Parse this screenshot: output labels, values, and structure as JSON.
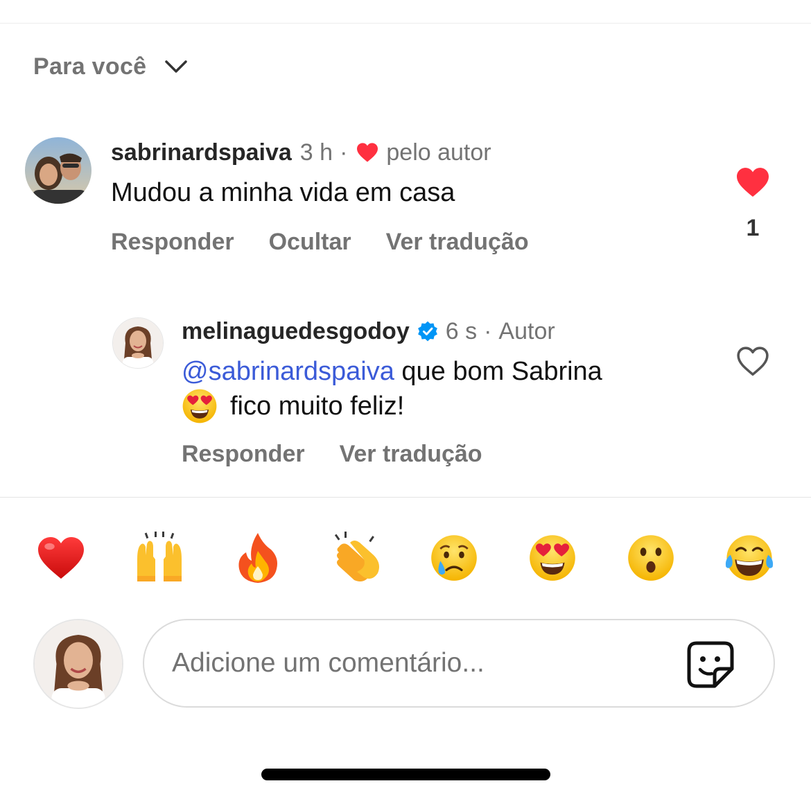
{
  "header": {
    "filter_label": "Para você"
  },
  "comments": [
    {
      "username": "sabrinardspaiva",
      "time": "3 h",
      "separator": "·",
      "liked_by_author_label": "pelo autor",
      "text": "Mudou a minha vida em casa",
      "actions": [
        "Responder",
        "Ocultar",
        "Ver tradução"
      ],
      "like_count": "1",
      "liked": true
    }
  ],
  "reply": {
    "username": "melinaguedesgodoy",
    "verified": true,
    "time": "6 s",
    "separator": "·",
    "role_label": "Autor",
    "mention": "@sabrinardspaiva",
    "text_line1": " que bom Sabrina",
    "text_line2": "fico muito feliz!",
    "actions": [
      "Responder",
      "Ver tradução"
    ],
    "liked": false
  },
  "quick_reactions": [
    "heart-emoji",
    "raising-hands-emoji",
    "fire-emoji",
    "clapping-hands-emoji",
    "crying-face-emoji",
    "heart-eyes-emoji",
    "surprised-face-emoji",
    "tears-of-joy-emoji"
  ],
  "composer": {
    "placeholder": "Adicione um comentário..."
  },
  "colors": {
    "like_red": "#ff3040",
    "mention_blue": "#3b5bd8",
    "verified_blue": "#0095f6",
    "muted_text": "#737373"
  }
}
